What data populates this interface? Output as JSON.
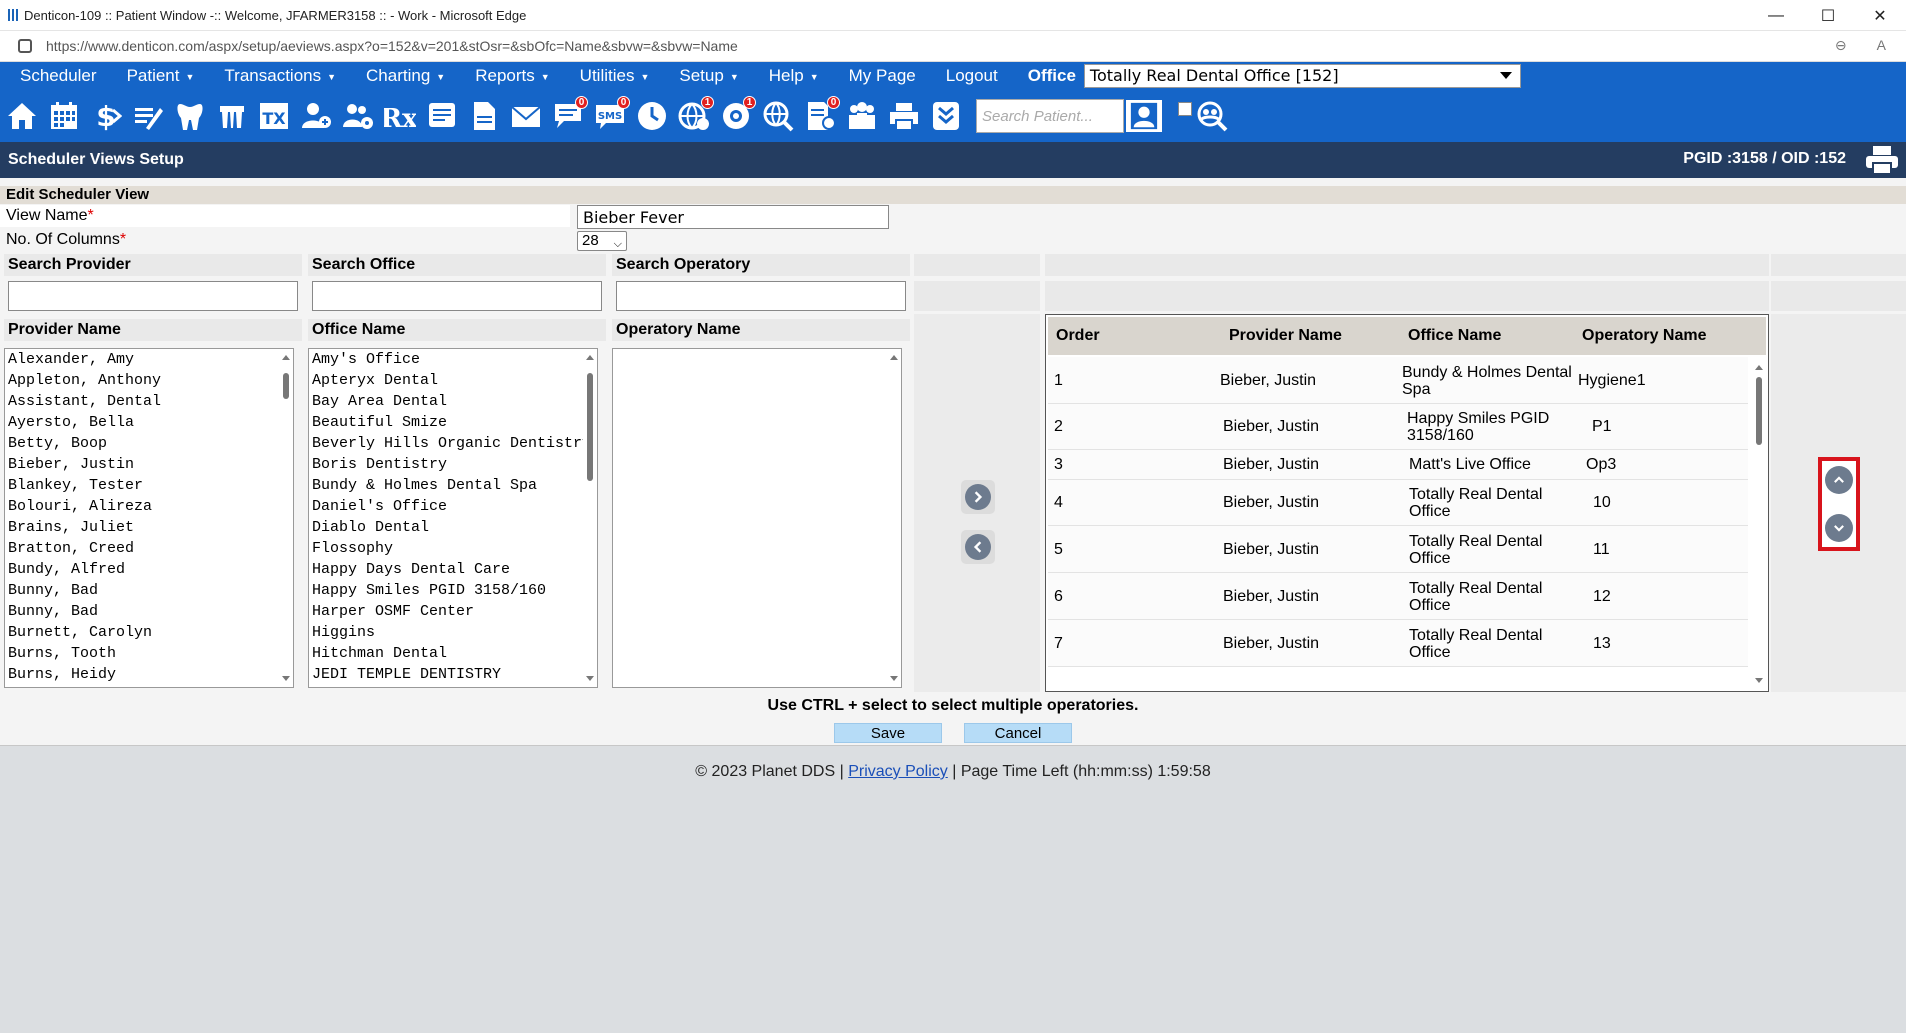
{
  "window": {
    "title": "Denticon-109 :: Patient Window -:: Welcome, JFARMER3158 :: - Work - Microsoft Edge",
    "url": "https://www.denticon.com/aspx/setup/aeviews.aspx?o=152&v=201&stOsr=&sbOfc=Name&sbvw=&sbvw=Name"
  },
  "menu": {
    "items": [
      {
        "label": "Scheduler",
        "caret": false
      },
      {
        "label": "Patient",
        "caret": true
      },
      {
        "label": "Transactions",
        "caret": true
      },
      {
        "label": "Charting",
        "caret": true
      },
      {
        "label": "Reports",
        "caret": true
      },
      {
        "label": "Utilities",
        "caret": true
      },
      {
        "label": "Setup",
        "caret": true
      },
      {
        "label": "Help",
        "caret": true
      },
      {
        "label": "My Page",
        "caret": false
      },
      {
        "label": "Logout",
        "caret": false
      }
    ],
    "office_label": "Office",
    "office_value": "Totally Real Dental Office [152]"
  },
  "toolbar": {
    "badges": {
      "sms": "0",
      "web": "1",
      "support": "1",
      "chat": "0"
    },
    "sms_label": "SMS",
    "tx_label": "TX",
    "rx_label": "Rx",
    "search_placeholder": "Search Patient..."
  },
  "page": {
    "title": "Scheduler Views Setup",
    "pgid": "PGID :3158  /  OID :152"
  },
  "form": {
    "section_title": "Edit Scheduler View",
    "view_name_label": "View Name",
    "view_name_value": "Bieber Fever",
    "columns_label": "No. Of Columns",
    "columns_value": "28",
    "required_mark": "*",
    "search_provider_label": "Search Provider",
    "search_office_label": "Search Office",
    "search_operatory_label": "Search Operatory",
    "provider_list_label": "Provider Name",
    "office_list_label": "Office Name",
    "operatory_list_label": "Operatory Name"
  },
  "providers": [
    "Alexander, Amy",
    "Appleton, Anthony",
    "Assistant, Dental",
    "Ayersto, Bella",
    "Betty, Boop",
    "Bieber, Justin",
    "Blankey, Tester",
    "Bolouri, Alireza",
    "Brains, Juliet",
    "Bratton, Creed",
    "Bundy, Alfred",
    "Bunny, Bad",
    "Bunny, Bad",
    "Burnett, Carolyn",
    "Burns, Tooth",
    "Burns, Heidy"
  ],
  "offices": [
    "Amy's Office",
    "Apteryx Dental",
    "Bay Area Dental",
    "Beautiful Smize",
    "Beverly Hills Organic Dentistry",
    "Boris Dentistry",
    "Bundy & Holmes Dental Spa",
    "Daniel's Office",
    "Diablo Dental",
    "Flossophy",
    "Happy Days Dental Care",
    "Happy Smiles PGID 3158/160",
    "Harper OSMF Center",
    "Higgins",
    "Hitchman Dental",
    "JEDI TEMPLE DENTISTRY"
  ],
  "order_table": {
    "headers": {
      "order": "Order",
      "provider": "Provider Name",
      "office": "Office Name",
      "operatory": "Operatory Name"
    },
    "rows": [
      {
        "order": "1",
        "provider": "Bieber, Justin",
        "office": [
          "Bundy & Holmes Dental",
          "Spa"
        ],
        "operatory": "Hygiene1"
      },
      {
        "order": "2",
        "provider": "Bieber, Justin",
        "office": [
          "Happy Smiles PGID",
          "3158/160"
        ],
        "operatory": "P1"
      },
      {
        "order": "3",
        "provider": "Bieber, Justin",
        "office": [
          "Matt's Live Office"
        ],
        "operatory": "Op3"
      },
      {
        "order": "4",
        "provider": "Bieber, Justin",
        "office": [
          "Totally Real Dental",
          "Office"
        ],
        "operatory": "10"
      },
      {
        "order": "5",
        "provider": "Bieber, Justin",
        "office": [
          "Totally Real Dental",
          "Office"
        ],
        "operatory": "11"
      },
      {
        "order": "6",
        "provider": "Bieber, Justin",
        "office": [
          "Totally Real Dental",
          "Office"
        ],
        "operatory": "12"
      },
      {
        "order": "7",
        "provider": "Bieber, Justin",
        "office": [
          "Totally Real Dental",
          "Office"
        ],
        "operatory": "13"
      }
    ]
  },
  "hint": "Use CTRL + select to select multiple operatories.",
  "buttons": {
    "save": "Save",
    "cancel": "Cancel"
  },
  "footer": {
    "copyright": "© 2023 Planet DDS | ",
    "privacy": "Privacy Policy",
    "separator": " | ",
    "time_left": " Page Time Left (hh:mm:ss) 1:59:58"
  },
  "colors": {
    "menu_blue": "#1565c8",
    "header_navy": "#243d61",
    "highlight_red": "#d8141c",
    "button_blue": "#b6dcf7"
  }
}
